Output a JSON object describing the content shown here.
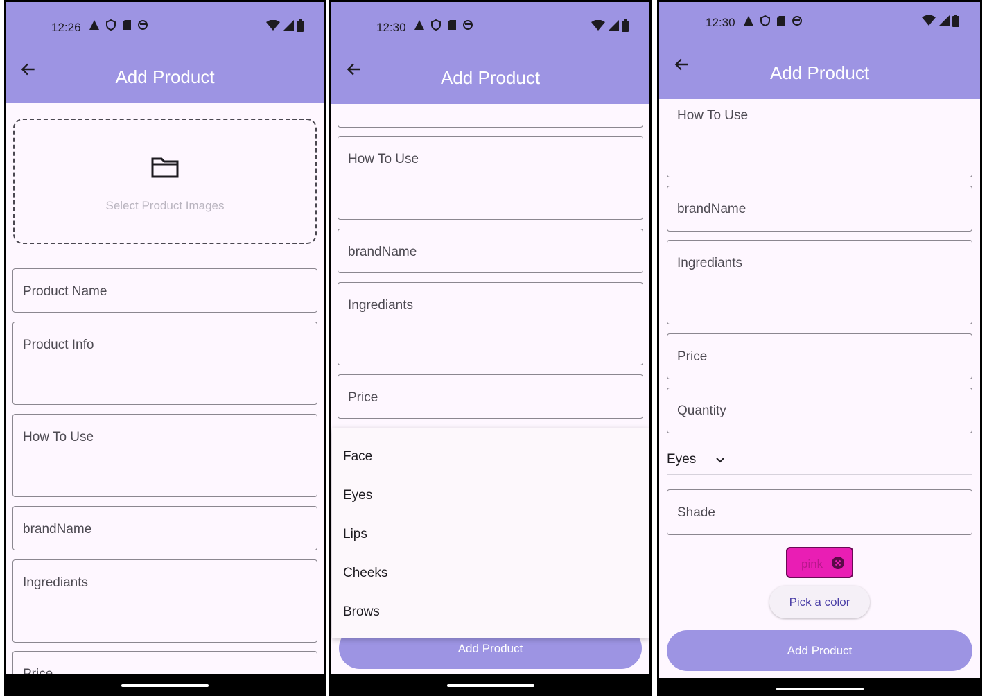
{
  "colors": {
    "appbar": "#9d94e3",
    "background": "#fef7ff",
    "chip": "#e91eb4",
    "accent_text": "#4a3ea6"
  },
  "screens": [
    {
      "status": {
        "time": "12:26"
      },
      "title": "Add Product",
      "image_picker": {
        "label": "Select Product Images",
        "icon": "folder-icon"
      },
      "fields": [
        "Product Name",
        "Product Info",
        "How To Use",
        "brandName",
        "Ingrediants",
        "Price"
      ]
    },
    {
      "status": {
        "time": "12:30"
      },
      "title": "Add Product",
      "fields": [
        "How To Use",
        "brandName",
        "Ingrediants",
        "Price"
      ],
      "menu_items": [
        "Face",
        "Eyes",
        "Lips",
        "Cheeks",
        "Brows"
      ],
      "submit_label": "Add Product"
    },
    {
      "status": {
        "time": "12:30"
      },
      "title": "Add Product",
      "fields": [
        "How To Use",
        "brandName",
        "Ingrediants",
        "Price",
        "Quantity"
      ],
      "category": {
        "selected": "Eyes"
      },
      "shade_field": "Shade",
      "color_chip": {
        "label": "pink"
      },
      "pick_color_label": "Pick a color",
      "submit_label": "Add Product"
    }
  ]
}
